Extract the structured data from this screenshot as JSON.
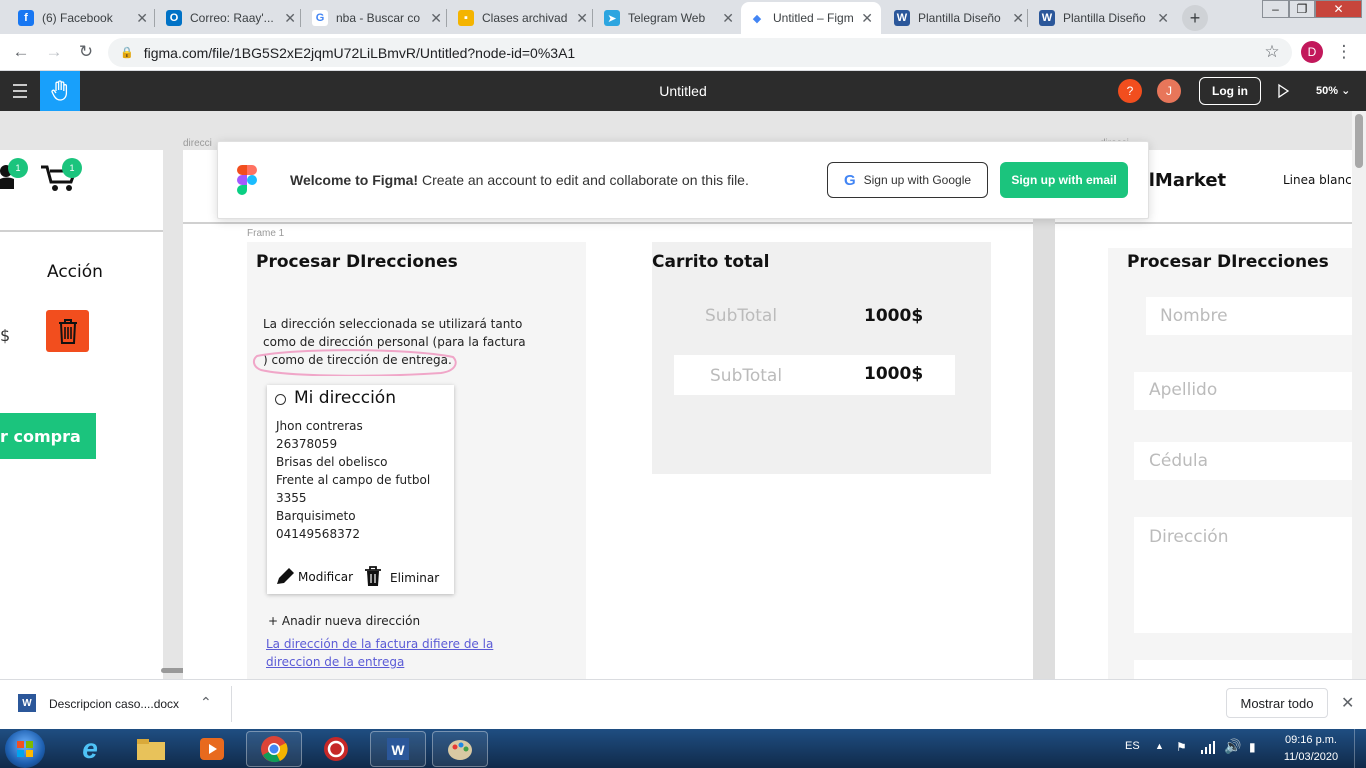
{
  "tabs": [
    {
      "title": "(6) Facebook",
      "icon": "facebook-icon",
      "color": "#1877f2",
      "glyph": "f"
    },
    {
      "title": "Correo: Raay'...",
      "icon": "outlook-icon",
      "color": "#0072c6",
      "glyph": "O"
    },
    {
      "title": "nba - Buscar co",
      "icon": "google-icon",
      "color": "#ffffff",
      "glyph": "G"
    },
    {
      "title": "Clases archivad",
      "icon": "classroom-icon",
      "color": "#f4b400",
      "glyph": "▪"
    },
    {
      "title": "Telegram Web",
      "icon": "telegram-icon",
      "color": "#2ca5e0",
      "glyph": "➤"
    },
    {
      "title": "Untitled – Figm",
      "icon": "figma-icon",
      "color": "#ffffff",
      "glyph": "◆"
    },
    {
      "title": "Plantilla Diseño",
      "icon": "word-icon",
      "color": "#2b579a",
      "glyph": "W"
    },
    {
      "title": "Plantilla Diseño",
      "icon": "word-icon",
      "color": "#2b579a",
      "glyph": "W"
    }
  ],
  "url": "figma.com/file/1BG5S2xE2jqmU72LiLBmvR/Untitled?node-id=0%3A1",
  "profile_initial": "D",
  "figma": {
    "title": "Untitled",
    "help": "?",
    "user_initial": "J",
    "login": "Log in",
    "zoom": "50%"
  },
  "banner": {
    "welcome_bold": "Welcome to Figma!",
    "welcome_rest": "Create an account to edit and collaborate on this file.",
    "google_btn": "Sign up with Google",
    "email_btn": "Sign up with email"
  },
  "canvas": {
    "frame_label_top": "direcci",
    "frame_label_right": "direcci",
    "frame1_label": "Frame 1",
    "badge_count_1": "1",
    "badge_count_2": "1",
    "accion": "Acción",
    "dollar": "$",
    "comprar": "r compra",
    "brand": "talMarket",
    "nav_item": "Linea blanca",
    "procesar_title": "Procesar DIrecciones",
    "info_text_1": "La dirección seleccionada se utilizará tanto",
    "info_text_2": "como de dirección personal (para la factura",
    "info_text_3": ") como de tirección de entrega.",
    "address": {
      "title": "Mi dirección",
      "lines": [
        "Jhon contreras",
        "26378059",
        "Brisas del obelisco",
        "Frente al campo de futbol",
        "3355",
        "Barquisimeto",
        "04149568372"
      ],
      "edit": "Modificar",
      "delete": "Eliminar"
    },
    "add_address": "+ Anadir nueva dirección",
    "link_line_1": "La dirección de la factura difiere de la",
    "link_line_2": "direccion de la entrega",
    "cart_title": "Carrito total",
    "subtotal_label_1": "SubTotal",
    "subtotal_value_1": "1000$",
    "subtotal_label_2": "SubTotal",
    "subtotal_value_2": "1000$",
    "right_title": "Procesar DIrecciones",
    "fields": [
      "Nombre",
      "Apellido",
      "Cédula",
      "Dirección"
    ]
  },
  "downloads": {
    "file": "Descripcion caso....docx",
    "show_all": "Mostrar todo"
  },
  "tray": {
    "lang": "ES",
    "time": "09:16 p.m.",
    "date": "11/03/2020"
  },
  "colors": {
    "figma_toolbar": "#2c2c2c",
    "hand_tool": "#18a0fb",
    "accent_green": "#1bc47d",
    "delete_orange": "#f24e1e",
    "highlight_pink": "#f0a6c8"
  }
}
